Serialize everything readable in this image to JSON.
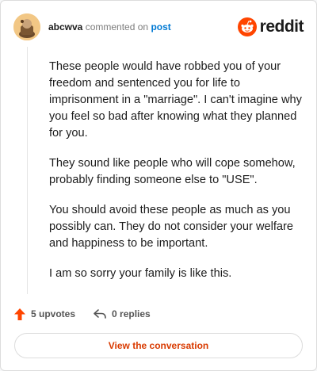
{
  "header": {
    "username": "abcwva",
    "action_text": "commented on",
    "post_link": "post",
    "brand_icon": "reddit-snoo-icon",
    "brand_wordmark": "reddit"
  },
  "comment": {
    "paragraphs": [
      "These people would have robbed you of your freedom and sentenced you for life to imprisonment in a \"marriage\". I can't imagine why you feel so bad after knowing what they planned for you.",
      "They sound like people who will cope somehow, probably finding someone else to \"USE\".",
      "You should avoid these people as much as you possibly can. They do not consider your welfare and happiness to be important.",
      "I am so sorry your family is like this."
    ]
  },
  "actions": {
    "upvotes": "5 upvotes",
    "upvote_icon": "upvote-arrow-icon",
    "replies": "0 replies",
    "reply_icon": "reply-arrow-icon"
  },
  "cta": {
    "label": "View the conversation"
  },
  "colors": {
    "accent": "#ff4500",
    "link": "#0079d3",
    "cta_text": "#d93a00",
    "avatar_bg": "#f2c785"
  }
}
